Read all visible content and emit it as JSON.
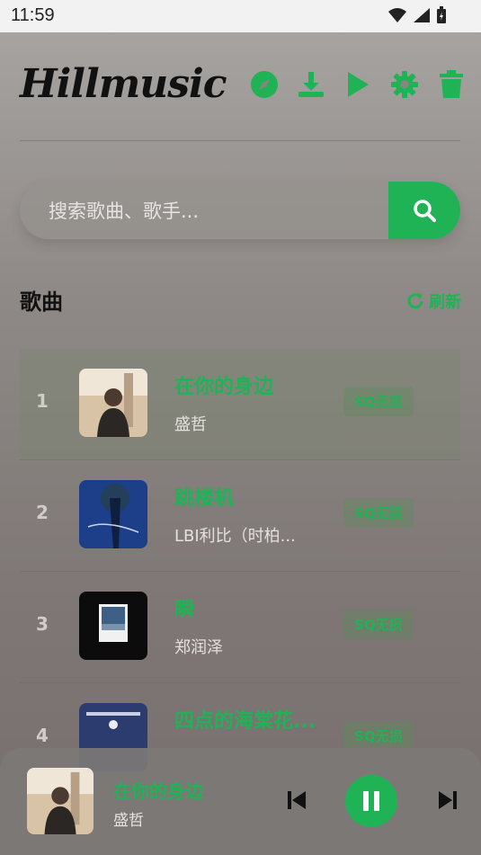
{
  "status": {
    "time": "11:59"
  },
  "app": {
    "logo": "Hillmusic"
  },
  "toolbar": {
    "explore_icon": "compass-icon",
    "download_icon": "download-icon",
    "play_icon": "play-icon",
    "settings_icon": "gear-icon",
    "delete_icon": "trash-icon"
  },
  "search": {
    "placeholder": "搜索歌曲、歌手..."
  },
  "section": {
    "title": "歌曲",
    "refresh": "刷新"
  },
  "songs": [
    {
      "index": "1",
      "title": "在你的身边",
      "artist": "盛哲",
      "badge": "SQ无损"
    },
    {
      "index": "2",
      "title": "跳楼机",
      "artist": "LBI利比（时柏...",
      "badge": "SQ无损"
    },
    {
      "index": "3",
      "title": "瞬",
      "artist": "郑润泽",
      "badge": "SQ无损"
    },
    {
      "index": "4",
      "title": "四点的海棠花...",
      "artist": "",
      "badge": "SQ无损"
    }
  ],
  "player": {
    "title": "在你的身边",
    "artist": "盛哲"
  },
  "colors": {
    "accent": "#1fb356"
  }
}
